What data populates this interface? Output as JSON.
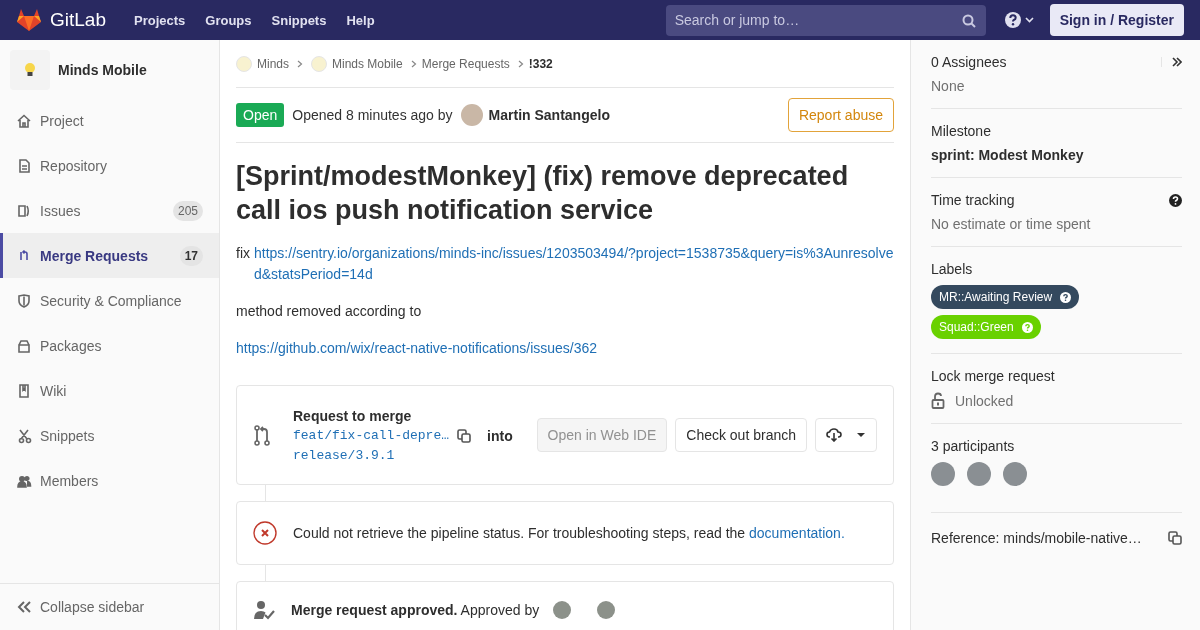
{
  "navbar": {
    "logo_text": "GitLab",
    "links": [
      "Projects",
      "Groups",
      "Snippets",
      "Help"
    ],
    "search": {
      "placeholder": "Search or jump to…"
    },
    "sign_in": "Sign in / Register"
  },
  "sidebar": {
    "project_name": "Minds Mobile",
    "items": [
      {
        "label": "Project",
        "kind": "home",
        "selected": false
      },
      {
        "label": "Repository",
        "kind": "doc",
        "selected": false
      },
      {
        "label": "Issues",
        "kind": "issues",
        "count": "205",
        "selected": false
      },
      {
        "label": "Merge Requests",
        "kind": "merge",
        "count": "17",
        "selected": true
      },
      {
        "label": "Security & Compliance",
        "kind": "shield",
        "selected": false
      },
      {
        "label": "Packages",
        "kind": "package",
        "selected": false
      },
      {
        "label": "Wiki",
        "kind": "book",
        "selected": false
      },
      {
        "label": "Snippets",
        "kind": "scissors",
        "selected": false
      },
      {
        "label": "Members",
        "kind": "users",
        "selected": false
      }
    ],
    "collapse": "Collapse sidebar"
  },
  "breadcrumbs": [
    {
      "label": "Minds",
      "avatar": true,
      "selected": false
    },
    {
      "label": "Minds Mobile",
      "avatar": true,
      "selected": false
    },
    {
      "label": "Merge Requests",
      "avatar": false,
      "selected": false
    },
    {
      "label": "!332",
      "avatar": false,
      "selected": true
    }
  ],
  "header": {
    "status": "Open",
    "opened": "Opened 8 minutes ago by",
    "author": "Martin Santangelo",
    "report": "Report abuse"
  },
  "title": "[Sprint/modestMonkey] (fix) remove deprecated call ios push notification service",
  "description": [
    [
      {
        "kind": "text",
        "text": "fix"
      },
      {
        "kind": "link",
        "text": "https://sentry.io/organizations/minds-inc/issues/1203503494/?project=1538735&query=is%3Aunresolved&statsPeriod=14d"
      }
    ],
    [
      {
        "kind": "text",
        "text": "method removed according to"
      }
    ],
    [
      {
        "kind": "link",
        "text": "https://github.com/wix/react-native-notifications/issues/362"
      }
    ]
  ],
  "merge_widget": {
    "title": "Request to merge",
    "source_branch": "feat/fix-call-depre…",
    "into": "into",
    "target_branch": "release/3.9.1",
    "buttons": [
      {
        "label": "Open in Web IDE",
        "disabled": true
      },
      {
        "label": "Check out branch",
        "disabled": false
      }
    ]
  },
  "pipeline": {
    "message": "Could not retrieve the pipeline status. For troubleshooting steps, read the",
    "link": "documentation."
  },
  "approval": {
    "message": "**Merge request approved.** Approved by"
  },
  "right_sidebar": {
    "assignees": {
      "title": "0 Assignees",
      "value": "None"
    },
    "milestone": {
      "title": "Milestone",
      "value": "sprint: Modest Monkey"
    },
    "time_tracking": {
      "title": "Time tracking",
      "value": "No estimate or time spent"
    },
    "labels": {
      "title": "Labels",
      "items": [
        {
          "text": "MR::Awaiting Review",
          "color": "#34495e"
        },
        {
          "text": "Squad::Green",
          "color": "#69d100"
        }
      ]
    },
    "lock": {
      "title": "Lock merge request",
      "value": "Unlocked"
    },
    "participants": {
      "title": "3 participants"
    },
    "reference": "Reference: minds/mobile-native…"
  }
}
